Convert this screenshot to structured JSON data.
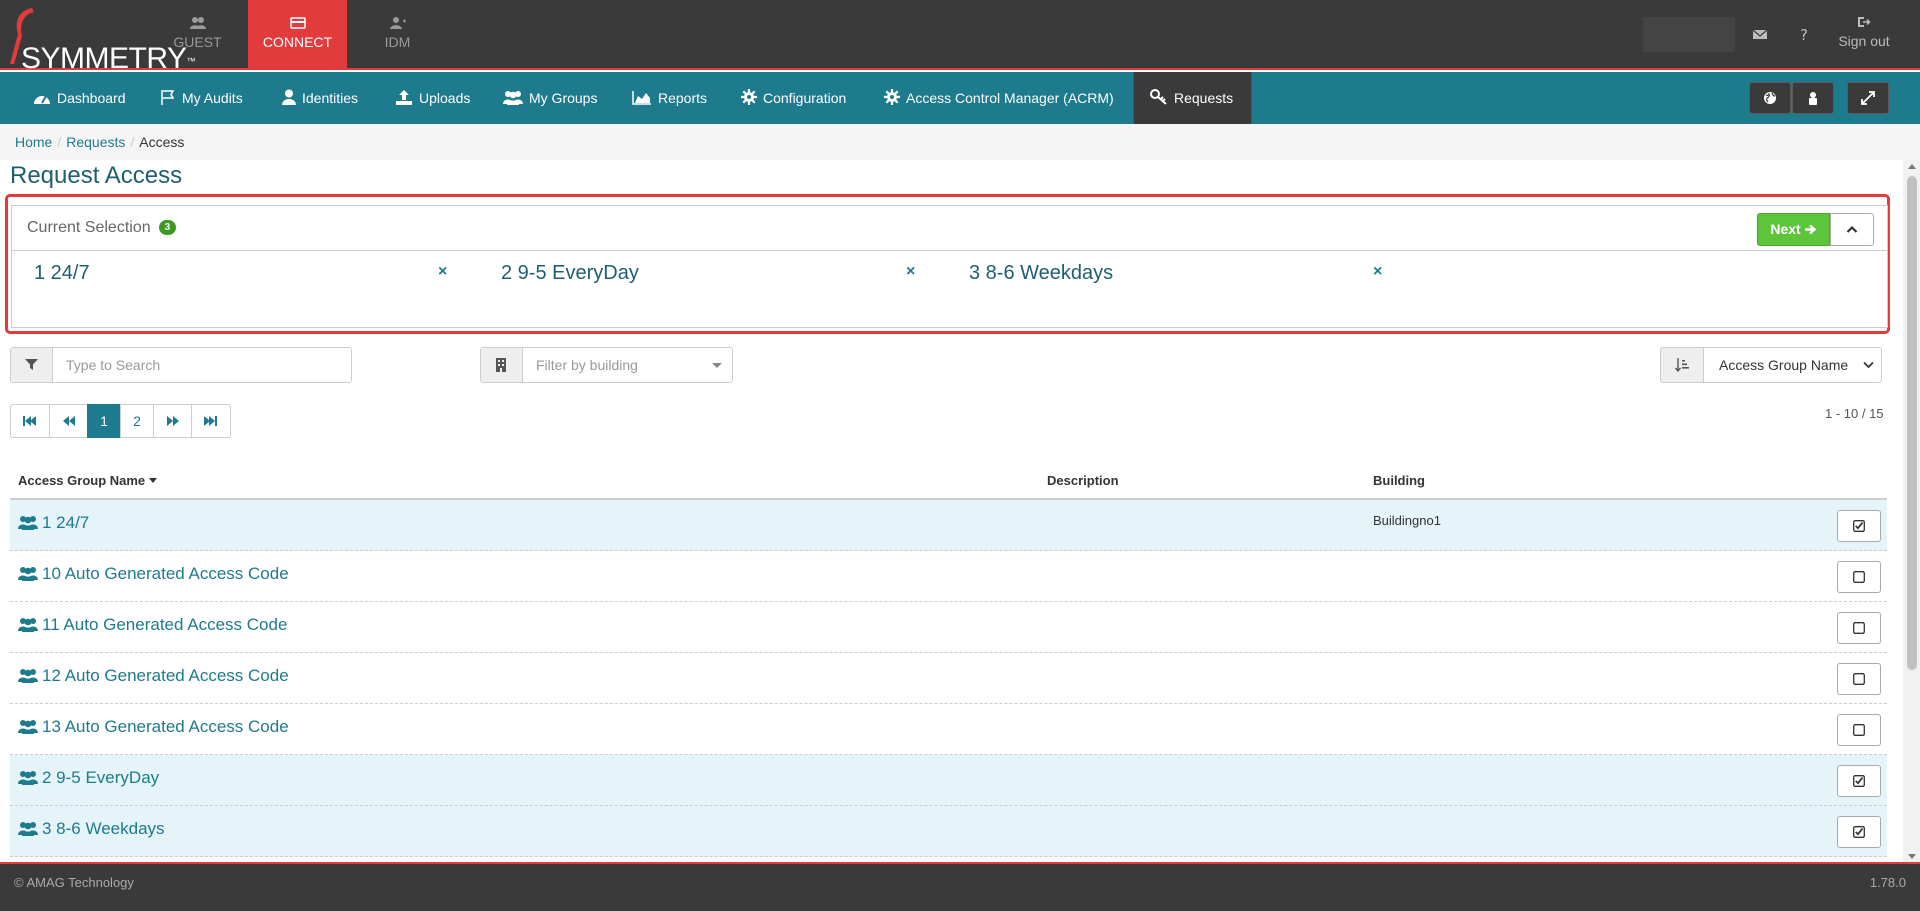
{
  "app": {
    "logo_text": "SYMMETRY",
    "logo_tm": "™",
    "tabs": [
      {
        "label": "GUEST",
        "icon": "guest-icon"
      },
      {
        "label": "CONNECT",
        "icon": "card-icon"
      },
      {
        "label": "IDM",
        "icon": "user-plus-icon"
      }
    ],
    "signout_label": "Sign out",
    "colors": {
      "brand": "#e23b3b",
      "nav": "#1e7a8d",
      "dark": "#3a3a3a",
      "success": "#5cc53a"
    }
  },
  "nav": {
    "items": [
      {
        "label": "Dashboard",
        "icon": "dashboard-icon"
      },
      {
        "label": "My Audits",
        "icon": "flag-icon"
      },
      {
        "label": "Identities",
        "icon": "user-icon"
      },
      {
        "label": "Uploads",
        "icon": "upload-icon"
      },
      {
        "label": "My Groups",
        "icon": "users-icon"
      },
      {
        "label": "Reports",
        "icon": "area-chart-icon"
      },
      {
        "label": "Configuration",
        "icon": "gear-icon"
      },
      {
        "label": "Access Control Manager (ACRM)",
        "icon": "gear-icon"
      },
      {
        "label": "Requests",
        "icon": "key-icon"
      }
    ],
    "active": "Requests"
  },
  "breadcrumb": [
    "Home",
    "Requests",
    "Access"
  ],
  "page": {
    "title": "Request Access"
  },
  "selection": {
    "title": "Current Selection",
    "count": "3",
    "next_label": "Next",
    "items": [
      "1 24/7",
      "2 9-5 EveryDay",
      "3 8-6 Weekdays"
    ],
    "remove_glyph": "×"
  },
  "filters": {
    "search_placeholder": "Type to Search",
    "building_placeholder": "Filter by building",
    "sort_selected": "Access Group Name"
  },
  "pagination": {
    "pages": [
      "1",
      "2"
    ],
    "current": "1",
    "range_text": "1 - 10 / 15"
  },
  "table": {
    "columns": [
      "Access Group Name",
      "Description",
      "Building"
    ],
    "rows": [
      {
        "name": "1 24/7",
        "description": "",
        "building": "Buildingno1",
        "checked": true
      },
      {
        "name": "10 Auto Generated Access Code",
        "description": "",
        "building": "",
        "checked": false
      },
      {
        "name": "11 Auto Generated Access Code",
        "description": "",
        "building": "",
        "checked": false
      },
      {
        "name": "12 Auto Generated Access Code",
        "description": "",
        "building": "",
        "checked": false
      },
      {
        "name": "13 Auto Generated Access Code",
        "description": "",
        "building": "",
        "checked": false
      },
      {
        "name": "2 9-5 EveryDay",
        "description": "",
        "building": "",
        "checked": true
      },
      {
        "name": "3 8-6 Weekdays",
        "description": "",
        "building": "",
        "checked": true
      }
    ]
  },
  "footer": {
    "copyright": "© AMAG Technology",
    "version": "1.78.0"
  }
}
